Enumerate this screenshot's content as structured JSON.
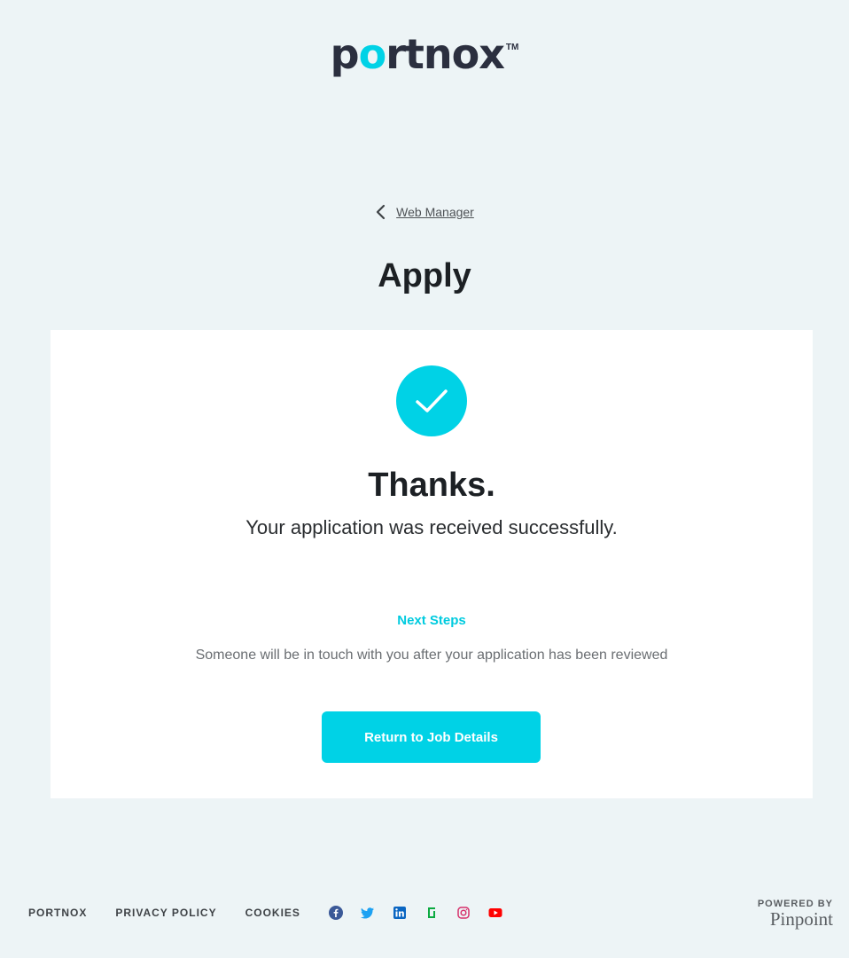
{
  "logo": {
    "text_start": "p",
    "text_o": "o",
    "text_end": "rtnox",
    "tm": "TM"
  },
  "breadcrumb": {
    "link_label": "Web Manager"
  },
  "page": {
    "title": "Apply"
  },
  "card": {
    "heading": "Thanks.",
    "message": "Your application was received successfully.",
    "next_steps_title": "Next Steps",
    "next_steps_text": "Someone will be in touch with you after your application has been reviewed",
    "button_label": "Return to Job Details"
  },
  "footer": {
    "links": [
      "PORTNOX",
      "PRIVACY POLICY",
      "COOKIES"
    ],
    "socials": [
      "facebook-icon",
      "twitter-icon",
      "linkedin-icon",
      "glassdoor-icon",
      "instagram-icon",
      "youtube-icon"
    ],
    "powered_by": "POWERED BY",
    "brand": "Pinpoint"
  },
  "colors": {
    "accent": "#00d2e6",
    "background": "#edf4f6",
    "card": "#ffffff",
    "text": "#1c2024"
  }
}
